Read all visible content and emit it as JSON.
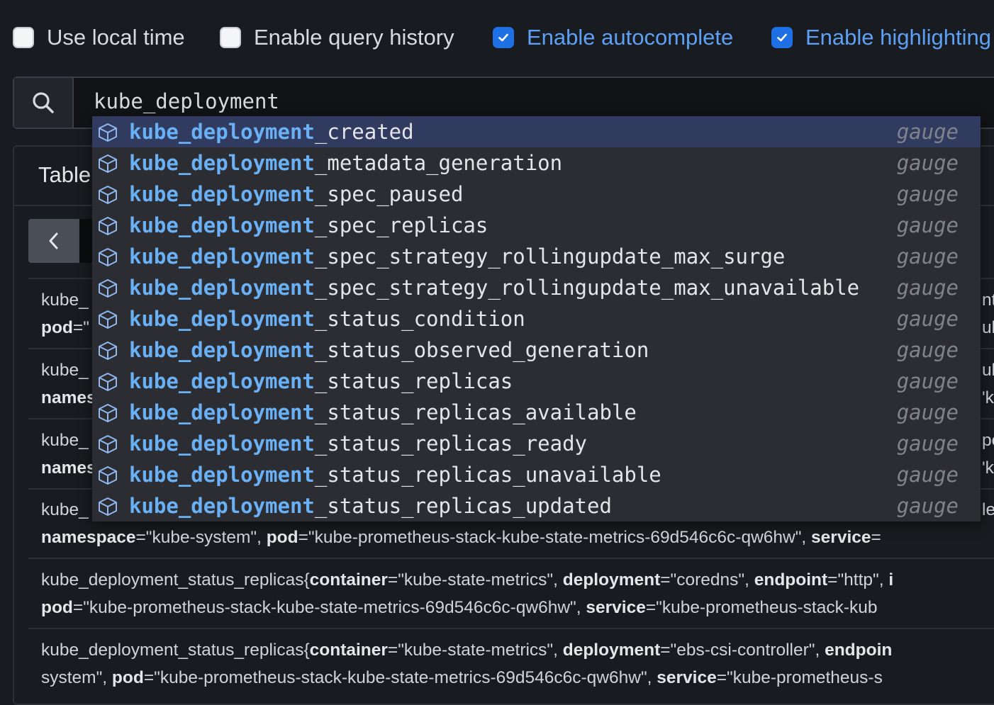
{
  "options": [
    {
      "label": "Use local time",
      "checked": false
    },
    {
      "label": "Enable query history",
      "checked": false
    },
    {
      "label": "Enable autocomplete",
      "checked": true
    },
    {
      "label": "Enable highlighting",
      "checked": true
    }
  ],
  "search": {
    "query": "kube_deployment"
  },
  "panel": {
    "tab_label": "Table"
  },
  "autocomplete": {
    "match": "kube_deployment",
    "items": [
      {
        "suffix": "_created",
        "type": "gauge"
      },
      {
        "suffix": "_metadata_generation",
        "type": "gauge"
      },
      {
        "suffix": "_spec_paused",
        "type": "gauge"
      },
      {
        "suffix": "_spec_replicas",
        "type": "gauge"
      },
      {
        "suffix": "_spec_strategy_rollingupdate_max_surge",
        "type": "gauge"
      },
      {
        "suffix": "_spec_strategy_rollingupdate_max_unavailable",
        "type": "gauge"
      },
      {
        "suffix": "_status_condition",
        "type": "gauge"
      },
      {
        "suffix": "_status_observed_generation",
        "type": "gauge"
      },
      {
        "suffix": "_status_replicas",
        "type": "gauge"
      },
      {
        "suffix": "_status_replicas_available",
        "type": "gauge"
      },
      {
        "suffix": "_status_replicas_ready",
        "type": "gauge"
      },
      {
        "suffix": "_status_replicas_unavailable",
        "type": "gauge"
      },
      {
        "suffix": "_status_replicas_updated",
        "type": "gauge"
      }
    ]
  },
  "results": {
    "partial": [
      {
        "line1": "kube_",
        "line2_key": "pod",
        "line2_rest": "=\"",
        "edge1": "nt",
        "edge2": "ub"
      },
      {
        "line1": "kube_",
        "line2_key": "names",
        "line2_rest": "",
        "edge1": "ub",
        "edge2": "'k"
      },
      {
        "line1": "kube_",
        "line2_key": "names",
        "line2_rest": "",
        "edge1": "pe",
        "edge2": "'k"
      },
      {
        "line1": "kube_",
        "edge1": "le"
      }
    ],
    "row4_line2": [
      {
        "k": "namespace",
        "v": "=\"kube-system\", "
      },
      {
        "k": "pod",
        "v": "=\"kube-prometheus-stack-kube-state-metrics-69d546c6c-qw6hw\", "
      },
      {
        "k": "service",
        "v": "="
      }
    ],
    "row5": {
      "metric": "kube_deployment_status_replicas{",
      "line1": [
        {
          "k": "container",
          "v": "=\"kube-state-metrics\", "
        },
        {
          "k": "deployment",
          "v": "=\"coredns\", "
        },
        {
          "k": "endpoint",
          "v": "=\"http\", "
        },
        {
          "k": "i",
          "v": ""
        }
      ],
      "line2": [
        {
          "k": "pod",
          "v": "=\"kube-prometheus-stack-kube-state-metrics-69d546c6c-qw6hw\", "
        },
        {
          "k": "service",
          "v": "=\"kube-prometheus-stack-kub"
        }
      ]
    },
    "row6": {
      "metric": "kube_deployment_status_replicas{",
      "line1": [
        {
          "k": "container",
          "v": "=\"kube-state-metrics\", "
        },
        {
          "k": "deployment",
          "v": "=\"ebs-csi-controller\", "
        },
        {
          "k": "endpoin",
          "v": ""
        }
      ],
      "line2_prefix": "system\", ",
      "line2": [
        {
          "k": "pod",
          "v": "=\"kube-prometheus-stack-kube-state-metrics-69d546c6c-qw6hw\", "
        },
        {
          "k": "service",
          "v": "=\"kube-prometheus-s"
        }
      ]
    }
  },
  "colors": {
    "accent": "#1f6fe5",
    "match": "#6ab0f5",
    "selected": "#313a5f"
  }
}
